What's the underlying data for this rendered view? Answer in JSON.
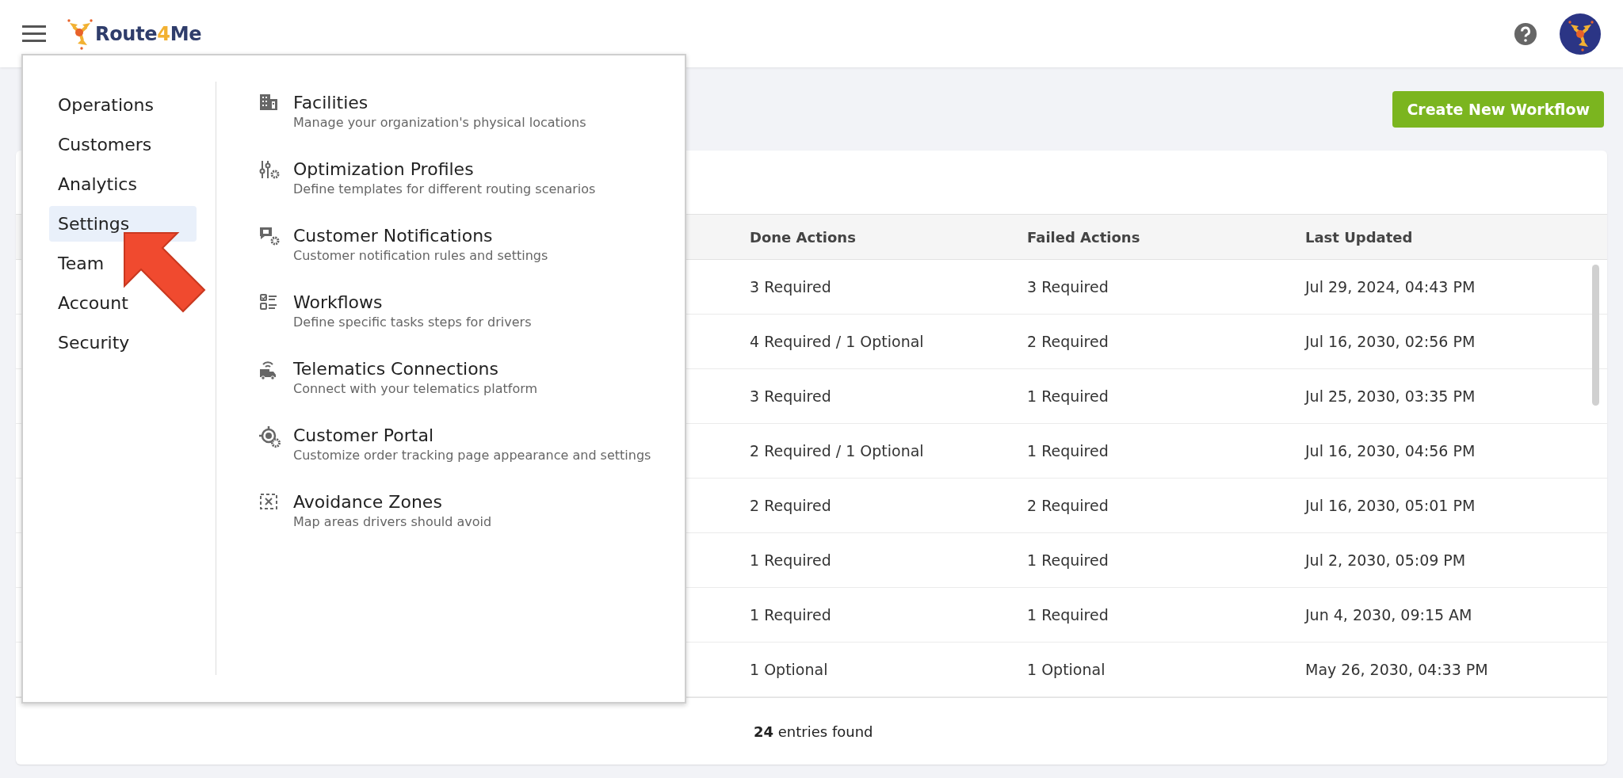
{
  "header": {
    "logo": [
      {
        "text": "Route",
        "accent": false
      },
      {
        "text": "4",
        "accent": true
      },
      {
        "text": "Me",
        "accent": false
      }
    ]
  },
  "toolbar": {
    "create_button": "Create New Workflow"
  },
  "table": {
    "columns": [
      "Done Actions",
      "Failed Actions",
      "Last Updated"
    ],
    "rows": [
      [
        "3 Required",
        "3 Required",
        "Jul 29, 2024, 04:43 PM"
      ],
      [
        "4 Required / 1 Optional",
        "2 Required",
        "Jul 16, 2030, 02:56 PM"
      ],
      [
        "3 Required",
        "1 Required",
        "Jul 25, 2030, 03:35 PM"
      ],
      [
        "2 Required / 1 Optional",
        "1 Required",
        "Jul 16, 2030, 04:56 PM"
      ],
      [
        "2 Required",
        "2 Required",
        "Jul 16, 2030, 05:01 PM"
      ],
      [
        "1 Required",
        "1 Required",
        "Jul 2, 2030, 05:09 PM"
      ],
      [
        "1 Required",
        "1 Required",
        "Jun 4, 2030, 09:15 AM"
      ],
      [
        "1 Optional",
        "1 Optional",
        "May 26, 2030, 04:33 PM"
      ]
    ],
    "footer": "**24** entries found"
  },
  "menu": {
    "sections": [
      {
        "label": "Operations",
        "selected": false
      },
      {
        "label": "Customers",
        "selected": false
      },
      {
        "label": "Analytics",
        "selected": false
      },
      {
        "label": "Settings",
        "selected": true
      },
      {
        "label": "Team",
        "selected": false
      },
      {
        "label": "Account",
        "selected": false
      },
      {
        "label": "Security",
        "selected": false
      }
    ],
    "items": [
      {
        "title": "Facilities",
        "description": "Manage your organization's physical locations"
      },
      {
        "title": "Optimization Profiles",
        "description": "Define templates for different routing scenarios"
      },
      {
        "title": "Customer Notifications",
        "description": "Customer notification rules and settings"
      },
      {
        "title": "Workflows",
        "description": "Define specific tasks steps for drivers"
      },
      {
        "title": "Telematics Connections",
        "description": "Connect with your telematics platform"
      },
      {
        "title": "Customer Portal",
        "description": "Customize order tracking page appearance and settings"
      },
      {
        "title": "Avoidance Zones",
        "description": "Map areas drivers should avoid"
      }
    ]
  }
}
